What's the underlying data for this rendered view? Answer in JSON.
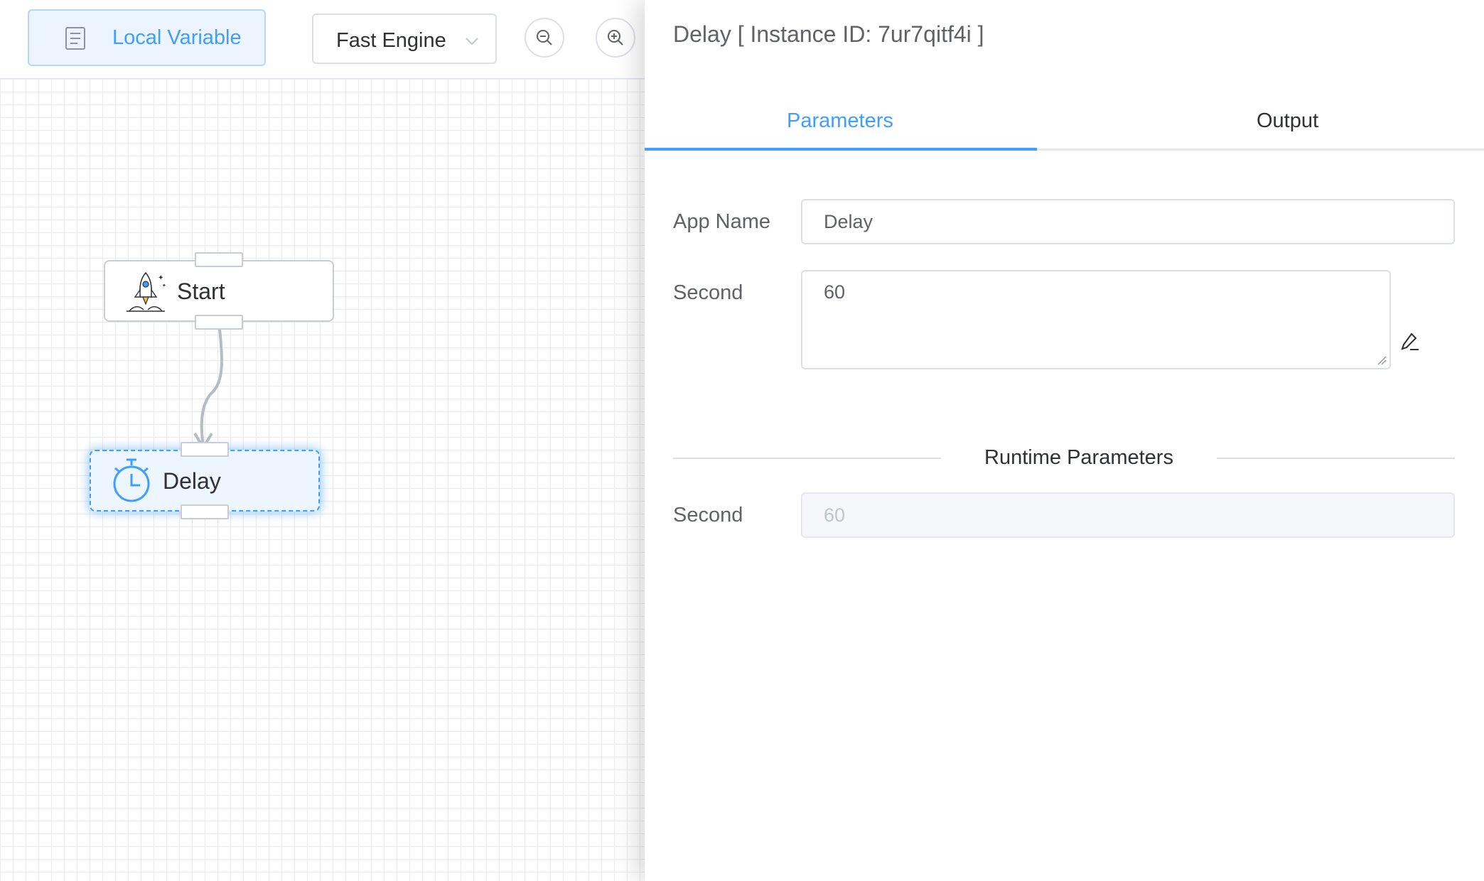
{
  "toolbar": {
    "local_variable_label": "Local Variable",
    "engine_select_value": "Fast Engine",
    "icons": {
      "local_variable": "document-icon",
      "engine_select": "chevron-down-icon",
      "zoom_out": "zoom-out-icon",
      "zoom_in": "zoom-in-icon"
    }
  },
  "flow": {
    "nodes": [
      {
        "label": "Start",
        "icon": "rocket-icon"
      },
      {
        "label": "Delay",
        "icon": "stopwatch-icon",
        "selected": true
      }
    ]
  },
  "drawer": {
    "title": "Delay [ Instance ID: 7ur7qitf4i ]",
    "tabs": [
      {
        "label": "Parameters",
        "active": true
      },
      {
        "label": "Output",
        "active": false
      }
    ],
    "form": {
      "app_name_label": "App Name",
      "app_name_value": "Delay",
      "second_label": "Second",
      "second_value": "60",
      "edit_icon": "edit-pen-icon"
    },
    "runtime": {
      "section_title": "Runtime Parameters",
      "second_label": "Second",
      "second_value": "60"
    }
  },
  "colors": {
    "accent": "#409eff",
    "accent_light_bg": "#ecf5ff",
    "border": "#dcdfe6",
    "text_primary": "#303133",
    "text_regular": "#606266",
    "disabled_text": "#c0c4cc",
    "disabled_bg": "#f5f7fa"
  }
}
